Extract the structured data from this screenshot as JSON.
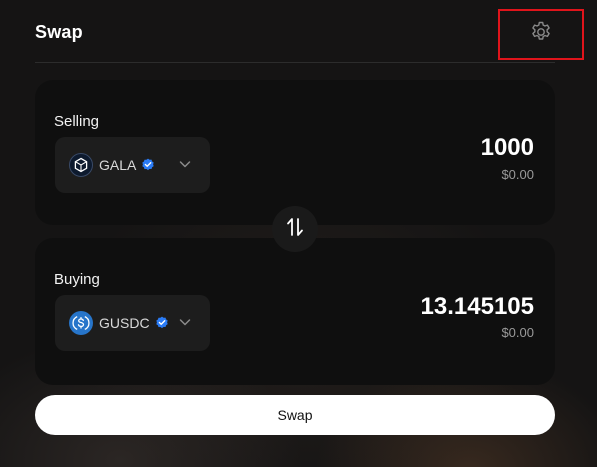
{
  "header": {
    "title": "Swap",
    "settings_icon": "gear-icon",
    "highlight_color": "#e0141b"
  },
  "selling": {
    "label": "Selling",
    "token": {
      "symbol": "GALA",
      "icon": "gala-logo",
      "verified": true
    },
    "amount": "1000",
    "usd_value": "$0.00"
  },
  "switch": {
    "icon": "swap-vertical-arrows-icon"
  },
  "buying": {
    "label": "Buying",
    "token": {
      "symbol": "GUSDC",
      "icon": "usdc-logo",
      "verified": true
    },
    "amount": "13.145105",
    "usd_value": "$0.00"
  },
  "action": {
    "swap_label": "Swap"
  },
  "colors": {
    "verified_badge": "#2a7bf5",
    "usdc_blue": "#2775ca",
    "card_bg": "#0f0f0f"
  }
}
